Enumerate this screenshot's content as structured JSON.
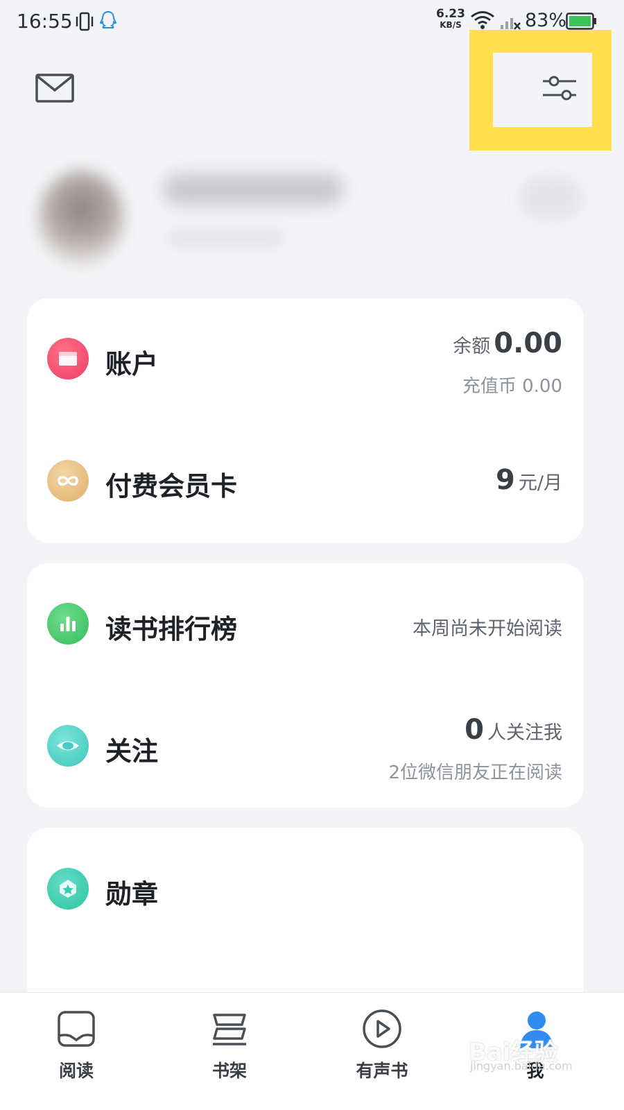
{
  "status_bar": {
    "time": "16:55",
    "net_speed_value": "6.23",
    "net_speed_unit": "KB/S",
    "battery": "83%",
    "icons": [
      "vibrate-icon",
      "qq-icon",
      "wifi-icon",
      "signal-icon",
      "battery-icon"
    ]
  },
  "header": {
    "icons": [
      "mail-icon",
      "settings-sliders-icon"
    ],
    "highlight_color": "#ffdf4b"
  },
  "card_account": {
    "account": {
      "label": "账户",
      "balance_label": "余额",
      "balance_value": "0.00",
      "coins_text": "充值币 0.00",
      "icon": "wallet-icon",
      "icon_color": "#f0466a"
    },
    "membership": {
      "label": "付费会员卡",
      "price_value": "9",
      "price_unit": "元/月",
      "icon": "infinity-icon",
      "icon_color": "#e5bc7c"
    }
  },
  "card_reading": {
    "ranking": {
      "label": "读书排行榜",
      "status": "本周尚未开始阅读",
      "icon": "bar-chart-icon",
      "icon_color": "#45c96a"
    },
    "follow": {
      "label": "关注",
      "followers_value": "0",
      "followers_text": "人关注我",
      "friends_text": "2位微信朋友正在阅读",
      "icon": "eye-icon",
      "icon_color": "#45cfc2"
    }
  },
  "card_medals": {
    "medals": {
      "label": "勋章",
      "icon": "medal-icon",
      "icon_color": "#33cfae"
    }
  },
  "tabbar": {
    "tabs": [
      {
        "label": "阅读",
        "icon": "book-icon"
      },
      {
        "label": "书架",
        "icon": "bookshelf-icon"
      },
      {
        "label": "有声书",
        "icon": "play-circle-icon"
      },
      {
        "label": "我",
        "icon": "person-icon",
        "active": true
      }
    ],
    "active_color": "#2f8cf0"
  },
  "watermark": {
    "text": "Bai经验",
    "sub": "jingyan.baidu.com"
  }
}
